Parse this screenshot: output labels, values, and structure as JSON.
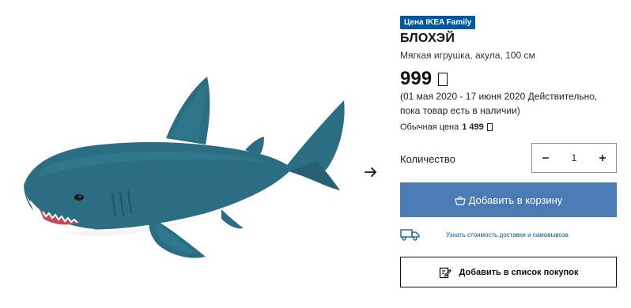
{
  "product": {
    "badge": "Цена IKEA Family",
    "name": "БЛОХЭЙ",
    "description": "Мягкая игрушка, акула, 100 см",
    "price": "999",
    "currency_symbol": "₽",
    "validity": "(01 мая 2020 - 17 июня 2020 Действительно, пока товар есть в наличии)",
    "regular_price_label": "Обычная цена",
    "regular_price": "1 499"
  },
  "quantity": {
    "label": "Количество",
    "value": "1",
    "decrement_icon": "minus-icon",
    "increment_icon": "plus-icon"
  },
  "actions": {
    "add_to_cart": "Добавить в корзину",
    "delivery_link": "Узнать стоимость доставки и самовывоза",
    "add_to_list": "Добавить в список покупок"
  },
  "colors": {
    "badge_bg": "#0058a3",
    "cart_button_bg": "#4a7bb5",
    "link_color": "#0058a3",
    "shark_body": "#2b6e83",
    "shark_belly": "#f4f4f4"
  }
}
